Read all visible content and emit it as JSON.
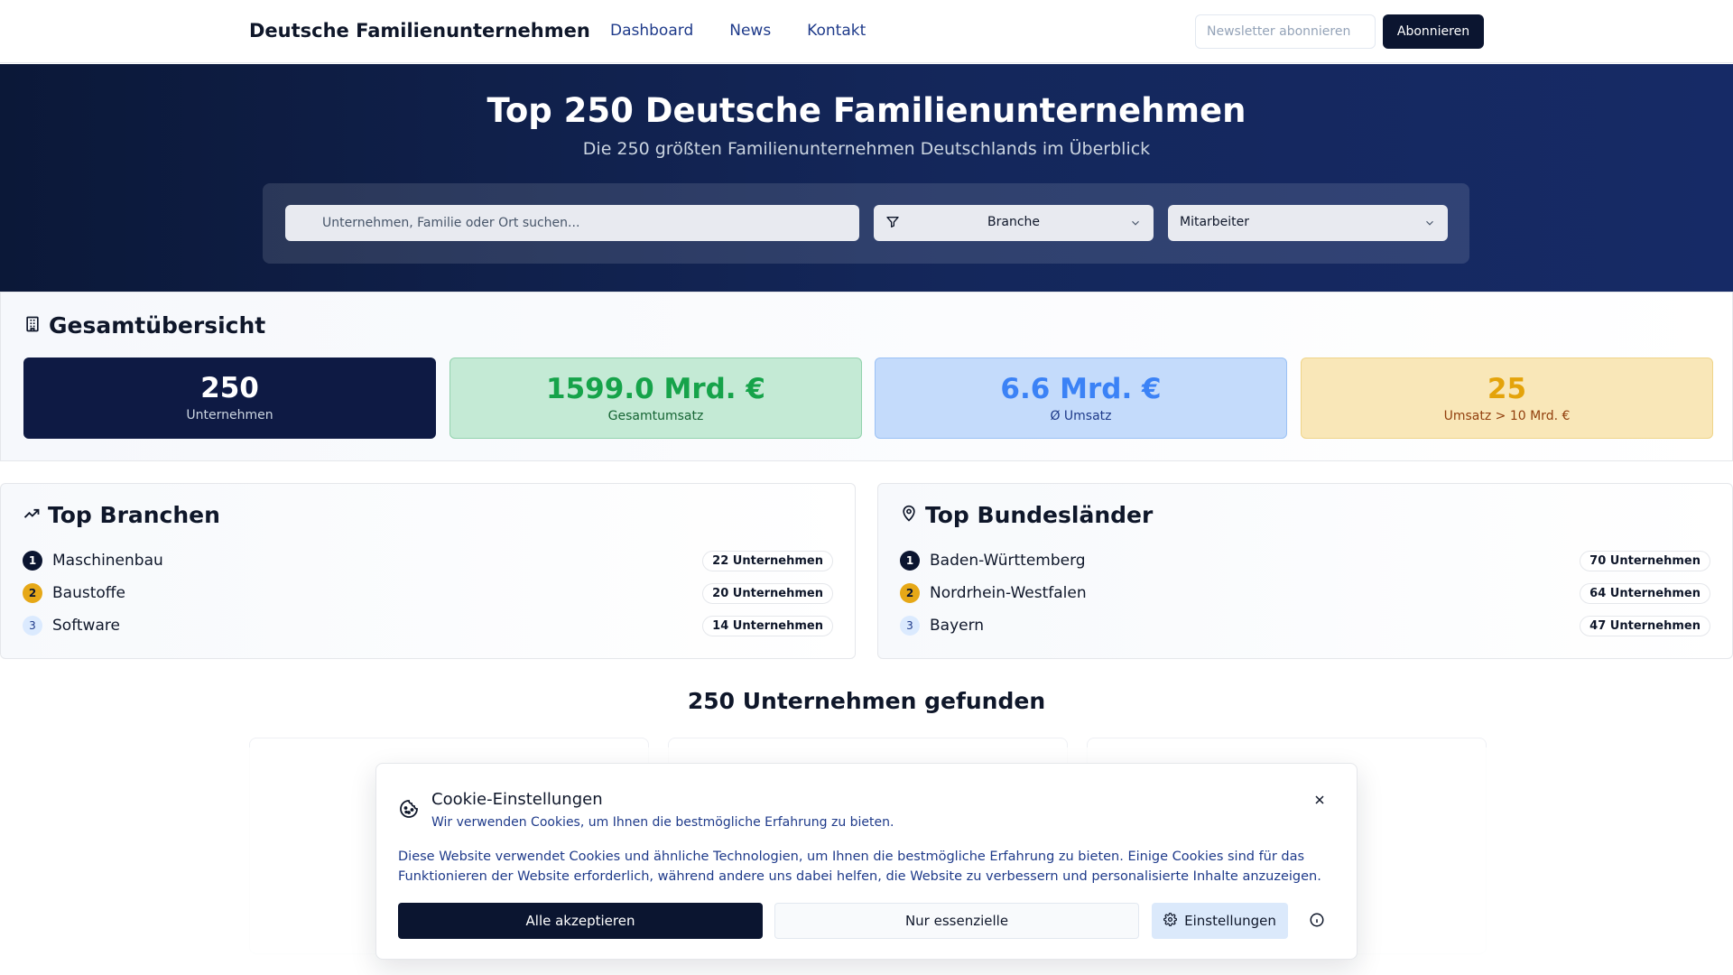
{
  "header": {
    "brand": "Deutsche Familienunternehmen",
    "nav": [
      "Dashboard",
      "News",
      "Kontakt"
    ],
    "newsletter_placeholder": "Newsletter abonnieren",
    "subscribe_label": "Abonnieren"
  },
  "hero": {
    "title": "Top 250 Deutsche Familienunternehmen",
    "subtitle": "Die 250 größten Familienunternehmen Deutschlands im Überblick",
    "search_placeholder": "Unternehmen, Familie oder Ort suchen...",
    "branche_label": "Branche",
    "mitarbeiter_label": "Mitarbeiter"
  },
  "overview": {
    "title": "Gesamtübersicht",
    "stats": [
      {
        "value": "250",
        "label": "Unternehmen"
      },
      {
        "value": "1599.0 Mrd. €",
        "label": "Gesamtumsatz"
      },
      {
        "value": "6.6 Mrd. €",
        "label": "Ø Umsatz"
      },
      {
        "value": "25",
        "label": "Umsatz > 10 Mrd. €"
      }
    ]
  },
  "top_branchen": {
    "title": "Top Branchen",
    "items": [
      {
        "rank": "1",
        "name": "Maschinenbau",
        "count": "22 Unternehmen"
      },
      {
        "rank": "2",
        "name": "Baustoffe",
        "count": "20 Unternehmen"
      },
      {
        "rank": "3",
        "name": "Software",
        "count": "14 Unternehmen"
      }
    ]
  },
  "top_bundeslaender": {
    "title": "Top Bundesländer",
    "items": [
      {
        "rank": "1",
        "name": "Baden-Württemberg",
        "count": "70 Unternehmen"
      },
      {
        "rank": "2",
        "name": "Nordrhein-Westfalen",
        "count": "64 Unternehmen"
      },
      {
        "rank": "3",
        "name": "Bayern",
        "count": "47 Unternehmen"
      }
    ]
  },
  "results": {
    "found_label": "250 Unternehmen gefunden"
  },
  "cookie": {
    "title": "Cookie-Einstellungen",
    "subtitle": "Wir verwenden Cookies, um Ihnen die bestmögliche Erfahrung zu bieten.",
    "text": "Diese Website verwendet Cookies und ähnliche Technologien, um Ihnen die bestmögliche Erfahrung zu bieten. Einige Cookies sind für das Funktionieren der Website erforderlich, während andere uns dabei helfen, die Website zu verbessern und personalisierte Inhalte anzuzeigen.",
    "accept_label": "Alle akzeptieren",
    "essential_label": "Nur essenzielle",
    "settings_label": "Einstellungen"
  },
  "colors": {
    "primary": "#0b1530",
    "green": "#16a34a",
    "blue": "#3b82f6",
    "gold": "#e4a30a"
  }
}
